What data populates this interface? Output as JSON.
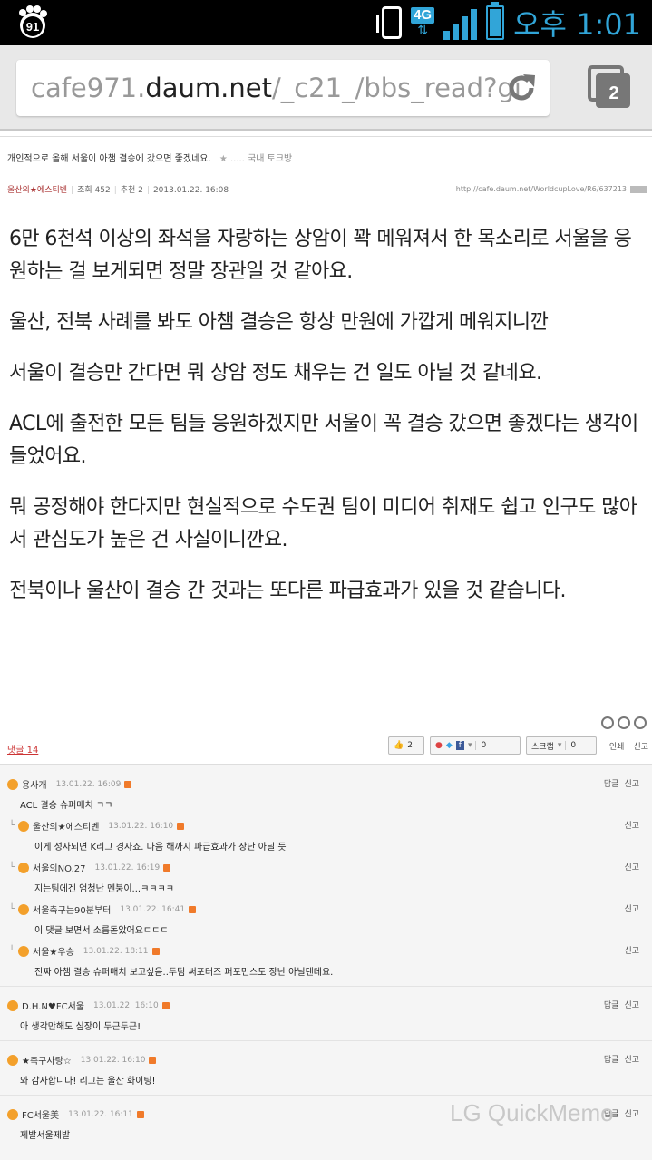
{
  "status_bar": {
    "badge": "91",
    "network": "4G",
    "time": "오후 1:01",
    "accent_color": "#31a5d8"
  },
  "browser": {
    "url_prefix": "cafe971.",
    "url_host": "daum.net",
    "url_path": "/_c21_/bbs_read?gı",
    "tab_count": "2",
    "reload_icon": "reload-icon",
    "tabs_icon": "tabs-icon"
  },
  "post": {
    "title": "개인적으로 올해 서울이 아챔 결승에 갔으면 좋겠네요.",
    "board_marker": "★ .....",
    "board": "국내 토크방",
    "author": "울산의★에스티벤",
    "views": "조회 452",
    "recommend": "추천 2",
    "date": "2013.01.22. 16:08",
    "permalink": "http://cafe.daum.net/WorldcupLove/R6/637213",
    "paragraphs": [
      "6만 6천석 이상의 좌석을 자랑하는 상암이 꽉 메워져서 한 목소리로 서울을 응원하는 걸 보게되면 정말 장관일 것 같아요.",
      "울산, 전북 사례를 봐도 아챔 결승은 항상 만원에 가깝게 메워지니깐",
      "서울이 결승만 간다면 뭐 상암 정도 채우는 건 일도 아닐 것 같네요.",
      "ACL에 출전한 모든 팀들 응원하겠지만 서울이 꼭 결승 갔으면 좋겠다는 생각이 들었어요.",
      "뭐 공정해야 한다지만 현실적으로 수도권 팀이 미디어 취재도 쉽고 인구도 많아서 관심도가 높은 건 사실이니깐요.",
      "전북이나 울산이 결승 간 것과는 또다른 파급효과가 있을 것 같습니다."
    ]
  },
  "toolbar": {
    "reply_count": "댓글 14",
    "like_count": "2",
    "share_count": "0",
    "scrap_label": "스크랩",
    "scrap_count": "0",
    "print_label": "인쇄",
    "report_label": "신고"
  },
  "comments": [
    {
      "nick": "용사개",
      "date": "13.01.22. 16:09",
      "text": "ACL 결승 슈퍼매치 ㄱㄱ",
      "reply": false,
      "actions": [
        "답글",
        "신고"
      ]
    },
    {
      "nick": "울산의★에스티벤",
      "date": "13.01.22. 16:10",
      "text": "이게 성사되면 K리그 경사죠. 다음 해까지 파급효과가 장난 아닐 듯",
      "reply": true,
      "actions": [
        "신고"
      ]
    },
    {
      "nick": "서울의NO.27",
      "date": "13.01.22. 16:19",
      "text": "지는팀에겐 엄청난 멘붕이...ㅋㅋㅋㅋ",
      "reply": true,
      "actions": [
        "신고"
      ]
    },
    {
      "nick": "서울축구는90분부터",
      "date": "13.01.22. 16:41",
      "text": "이 댓글 보면서 소름돋았어요ㄷㄷㄷ",
      "reply": true,
      "actions": [
        "신고"
      ]
    },
    {
      "nick": "서울★우승",
      "date": "13.01.22. 18:11",
      "text": "진짜 아챔 결승 슈퍼매치 보고싶음..두팀 써포터즈 퍼포먼스도 장난 아닐텐데요.",
      "reply": true,
      "actions": [
        "신고"
      ]
    },
    {
      "nick": "D.H.N♥FC서울",
      "date": "13.01.22. 16:10",
      "text": "아 생각만해도 심장이 두근두근!",
      "reply": false,
      "actions": [
        "답글",
        "신고"
      ]
    },
    {
      "nick": "★축구사랑☆",
      "date": "13.01.22. 16:10",
      "text": "와 감사합니다! 리그는 울산 화이팅!",
      "reply": false,
      "actions": [
        "답글",
        "신고"
      ]
    },
    {
      "nick": "FC서울美",
      "date": "13.01.22. 16:11",
      "text": "제발서울제발",
      "reply": false,
      "actions": [
        "답글",
        "신고"
      ]
    }
  ],
  "watermark": "LG QuickMemo"
}
